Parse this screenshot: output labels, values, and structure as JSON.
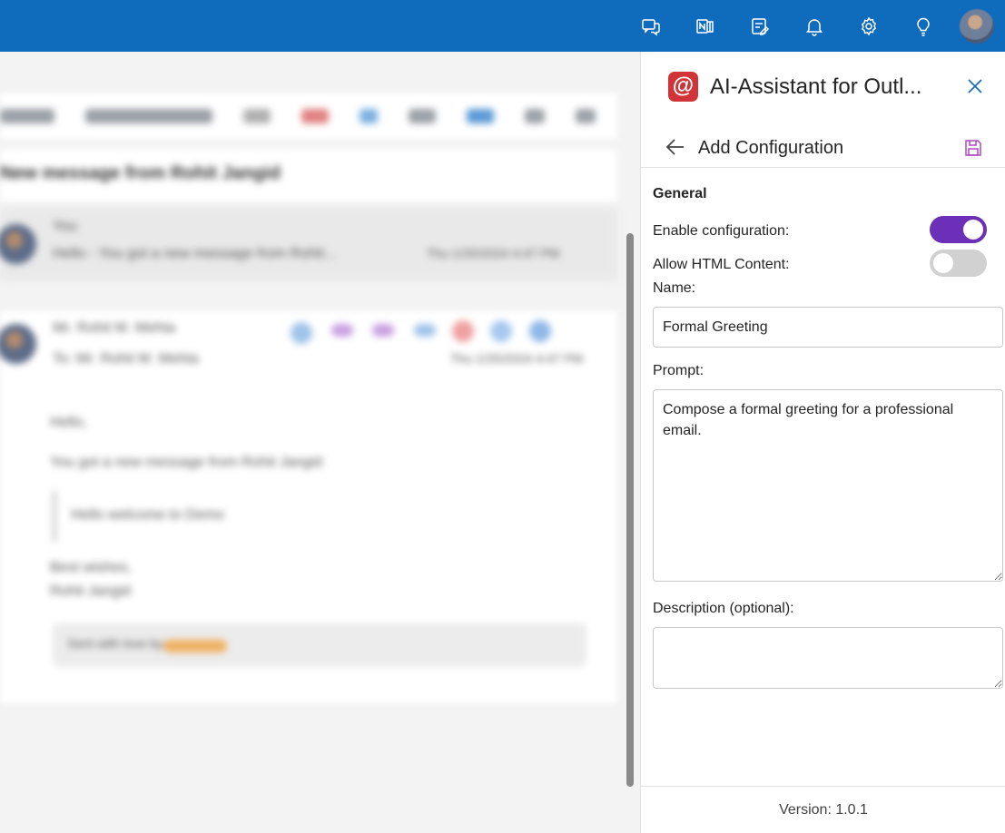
{
  "topbar": {
    "color": "#0f6cbd",
    "icons": [
      "feedback-icon",
      "onenote-icon",
      "my-day-icon",
      "notifications-icon",
      "settings-icon",
      "tips-icon"
    ]
  },
  "mail": {
    "subject": "New message from Rohit Jangid",
    "item1_sender": "You",
    "item1_preview": "Hello - You got a new message from Rohit...",
    "item1_date": "Thu 1/25/2024 4:47 PM",
    "msg_sender": "Mr. Rohit M. Mehta",
    "msg_to": "To: Mr. Rohit M. Mehta",
    "msg_date": "Thu 1/25/2024 4:47 PM",
    "body_greeting": "Hello,",
    "body_line": "You got a new message from Rohit Jangid",
    "body_quote": "Hello welcome to Demo",
    "body_signoff_1": "Best wishes,",
    "body_signoff_2": "Rohit Jangid",
    "body_footer": "Sent with love by"
  },
  "pane": {
    "title": "AI-Assistant for Outl...",
    "logo_glyph": "@",
    "logo_color": "#d13438",
    "subheader": "Add Configuration",
    "section_general": "General",
    "enable_label": "Enable configuration:",
    "enable_on": true,
    "html_label": "Allow HTML Content:",
    "html_on": false,
    "toggle_on_color": "#6b2fb8",
    "name_label": "Name:",
    "name_value": "Formal Greeting",
    "prompt_label": "Prompt:",
    "prompt_value": "Compose a formal greeting for a professional email.",
    "description_label": "Description (optional):",
    "description_value": "",
    "version": "Version: 1.0.1"
  }
}
